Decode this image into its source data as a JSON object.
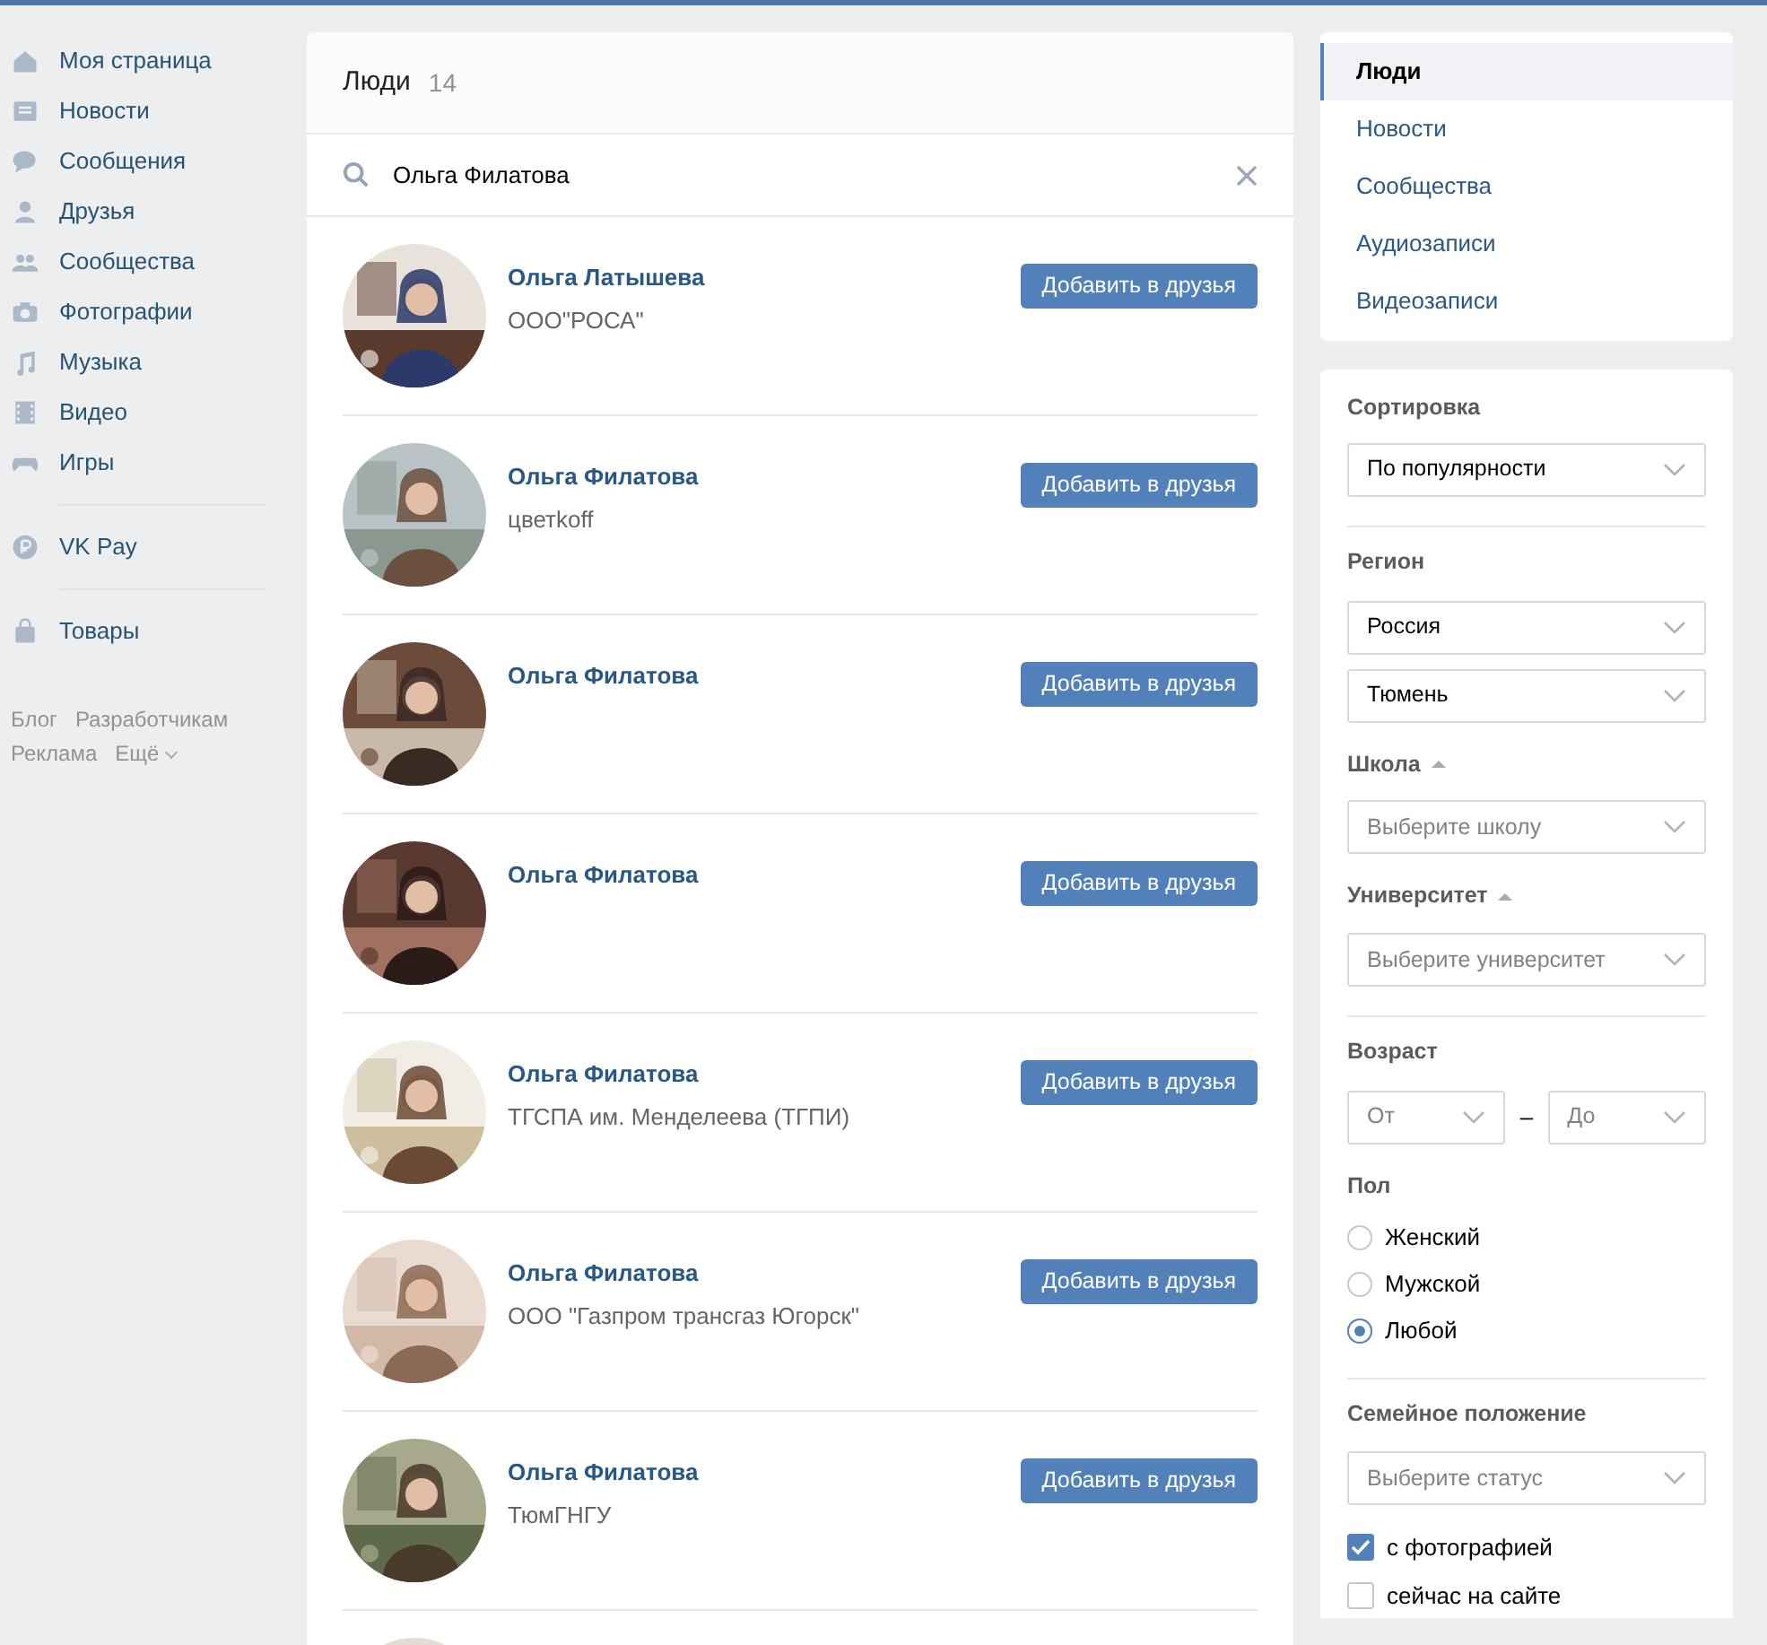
{
  "sidebar": {
    "items": [
      {
        "label": "Моя страница"
      },
      {
        "label": "Новости"
      },
      {
        "label": "Сообщения"
      },
      {
        "label": "Друзья"
      },
      {
        "label": "Сообщества"
      },
      {
        "label": "Фотографии"
      },
      {
        "label": "Музыка"
      },
      {
        "label": "Видео"
      },
      {
        "label": "Игры"
      }
    ],
    "extra_items": [
      {
        "label": "VK Pay"
      },
      {
        "label": "Товары"
      }
    ],
    "footer_links": [
      {
        "label": "Блог"
      },
      {
        "label": "Разработчикам"
      },
      {
        "label": "Реклама"
      },
      {
        "label": "Ещё"
      }
    ]
  },
  "results": {
    "title": "Люди",
    "count": "14",
    "search": {
      "value": "Ольга Филатова"
    },
    "rows": [
      {
        "kind": "person",
        "name": "Ольга Латышева",
        "info": "ООО\"РОСА\"",
        "button": "Добавить в друзья"
      },
      {
        "kind": "person",
        "name": "Ольга Филатова",
        "info": "цветkoff",
        "button": "Добавить в друзья"
      },
      {
        "kind": "person",
        "name": "Ольга Филатова",
        "button": "Добавить в друзья"
      },
      {
        "kind": "person",
        "name": "Ольга Филатова",
        "button": "Добавить в друзья"
      },
      {
        "kind": "person",
        "name": "Ольга Филатова",
        "info": "ТГСПА им. Менделеева (ТГПИ)",
        "button": "Добавить в друзья"
      },
      {
        "kind": "person",
        "name": "Ольга Филатова",
        "info": "ООО \"Газпром трансгаз Югорск\"",
        "button": "Добавить в друзья"
      },
      {
        "kind": "person",
        "name": "Ольга Филатова",
        "info": "ТюмГНГУ",
        "button": "Добавить в друзья"
      },
      {
        "kind": "partial"
      }
    ]
  },
  "tabs": [
    {
      "label": "Люди",
      "selected": true
    },
    {
      "label": "Новости",
      "selected": false
    },
    {
      "label": "Сообщества",
      "selected": false
    },
    {
      "label": "Аудиозаписи",
      "selected": false
    },
    {
      "label": "Видеозаписи",
      "selected": false
    }
  ],
  "filters": {
    "sort": {
      "label": "Сортировка",
      "value": "По популярности"
    },
    "region": {
      "label": "Регион",
      "country": "Россия",
      "city": "Тюмень"
    },
    "school": {
      "label": "Школа",
      "placeholder": "Выберите школу"
    },
    "university": {
      "label": "Университет",
      "placeholder": "Выберите университет"
    },
    "age": {
      "label": "Возраст",
      "from": "От",
      "dash": "–",
      "to": "До"
    },
    "sex": {
      "label": "Пол",
      "options": [
        {
          "label": "Женский",
          "selected": false
        },
        {
          "label": "Мужской",
          "selected": false
        },
        {
          "label": "Любой",
          "selected": true
        }
      ]
    },
    "relationship": {
      "label": "Семейное положение",
      "placeholder": "Выберите статус"
    },
    "checkboxes": [
      {
        "label": "с фотографией",
        "checked": true
      },
      {
        "label": "сейчас на сайте",
        "checked": false
      }
    ]
  }
}
